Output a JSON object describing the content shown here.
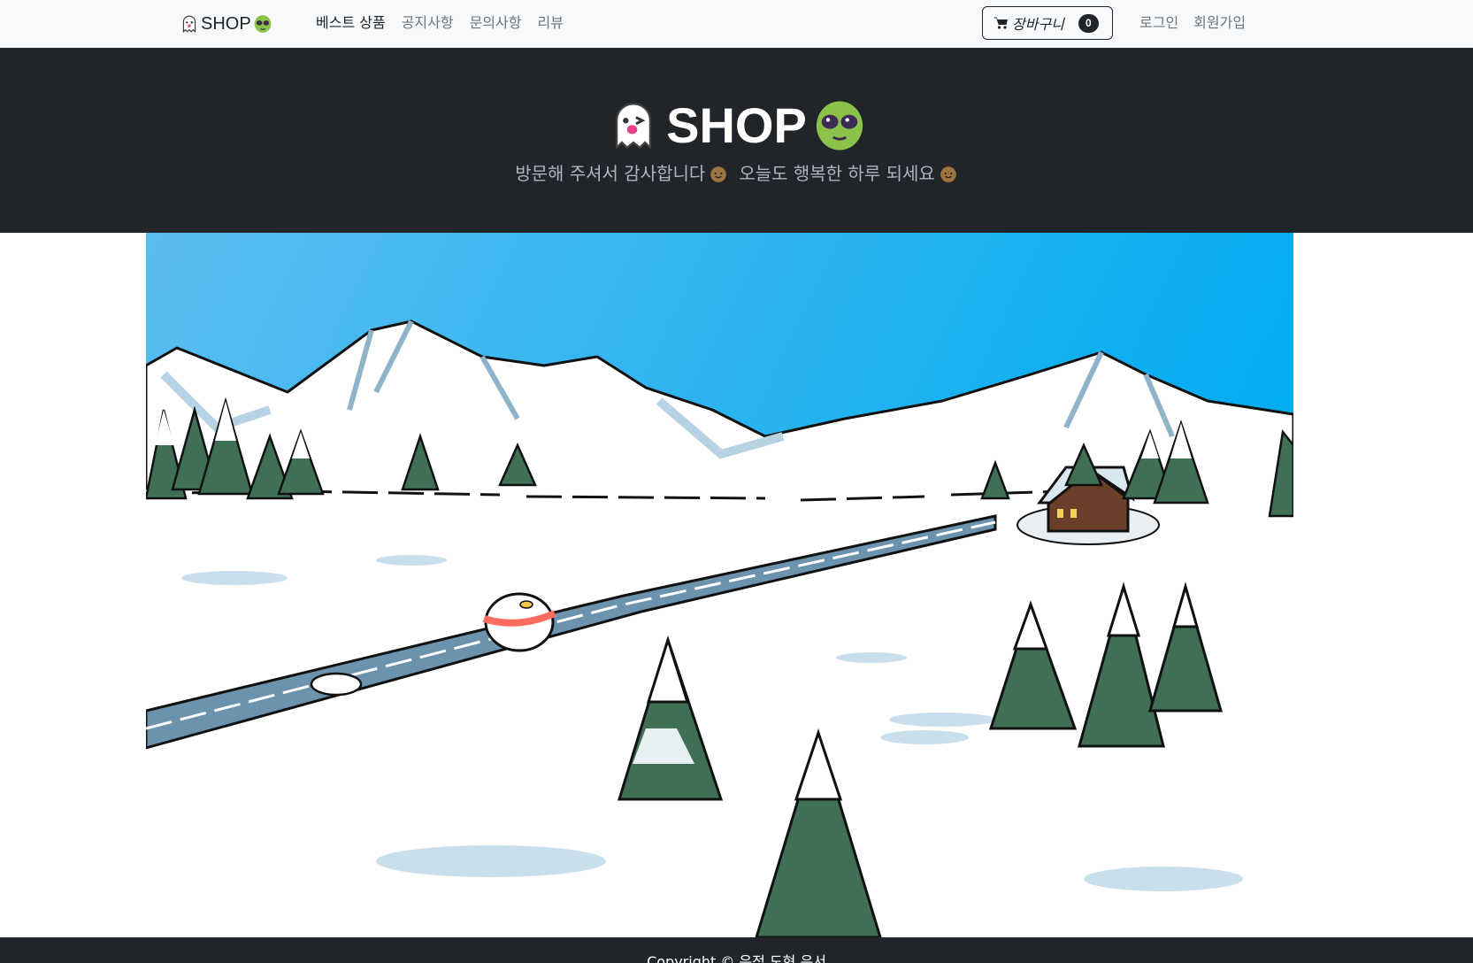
{
  "navbar": {
    "brand": "SHOP",
    "links": [
      {
        "label": "베스트 상품",
        "active": true
      },
      {
        "label": "공지사항",
        "active": false
      },
      {
        "label": "문의사항",
        "active": false
      },
      {
        "label": "리뷰",
        "active": false
      }
    ],
    "cart": {
      "label": "장바구니",
      "count": "0"
    },
    "auth": {
      "login": "로그인",
      "signup": "회원가입"
    }
  },
  "hero": {
    "title": "SHOP",
    "subtitle_part1": "방문해 주셔서 감사합니다",
    "subtitle_part2": "오늘도 행복한 하루 되세요"
  },
  "banner": {
    "icon": "winter-landscape-illustration"
  },
  "footer": {
    "copyright": "Copyright © 은정 도현 은서"
  },
  "colors": {
    "navbar_bg": "#f8f9fa",
    "dark": "#212529",
    "muted": "#6c757d",
    "sky": "#2fa9ea"
  }
}
